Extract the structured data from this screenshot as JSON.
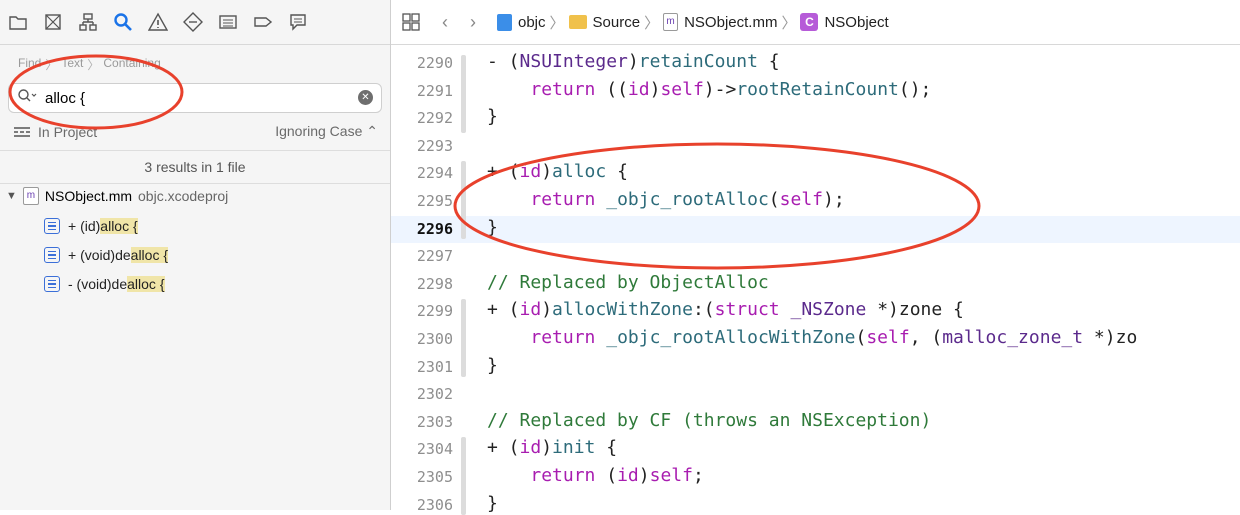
{
  "navigator": {
    "breadcrumb": [
      "Find",
      "Text",
      "Containing"
    ],
    "search": {
      "value": "alloc {"
    },
    "scope_left": "In Project",
    "scope_right": "Ignoring Case",
    "results_summary": "3 results in 1 file",
    "file": {
      "name": "NSObject.mm",
      "project": "objc.xcodeproj"
    },
    "results": [
      {
        "pre": "+ (id)",
        "match": "alloc {"
      },
      {
        "pre": "+ (void)de",
        "match": "alloc {"
      },
      {
        "pre": "- (void)de",
        "match": "alloc {"
      }
    ]
  },
  "jumpbar": {
    "items": [
      "objc",
      "Source",
      "NSObject.mm",
      "NSObject"
    ]
  },
  "editor": {
    "current_line": 2296,
    "lines": [
      {
        "n": "2290",
        "t": "- (NSUInteger)retainCount {"
      },
      {
        "n": "2291",
        "t": "    return ((id)self)->rootRetainCount();"
      },
      {
        "n": "2292",
        "t": "}"
      },
      {
        "n": "2293",
        "t": ""
      },
      {
        "n": "2294",
        "t": "+ (id)alloc {"
      },
      {
        "n": "2295",
        "t": "    return _objc_rootAlloc(self);"
      },
      {
        "n": "2296",
        "t": "}"
      },
      {
        "n": "2297",
        "t": ""
      },
      {
        "n": "2298",
        "t": "// Replaced by ObjectAlloc"
      },
      {
        "n": "2299",
        "t": "+ (id)allocWithZone:(struct _NSZone *)zone {"
      },
      {
        "n": "2300",
        "t": "    return _objc_rootAllocWithZone(self, (malloc_zone_t *)zo"
      },
      {
        "n": "2301",
        "t": "}"
      },
      {
        "n": "2302",
        "t": ""
      },
      {
        "n": "2303",
        "t": "// Replaced by CF (throws an NSException)"
      },
      {
        "n": "2304",
        "t": "+ (id)init {"
      },
      {
        "n": "2305",
        "t": "    return (id)self;"
      },
      {
        "n": "2306",
        "t": "}"
      }
    ]
  },
  "colors": {
    "accent": "#1a73e8",
    "annotation": "#e8412c"
  }
}
